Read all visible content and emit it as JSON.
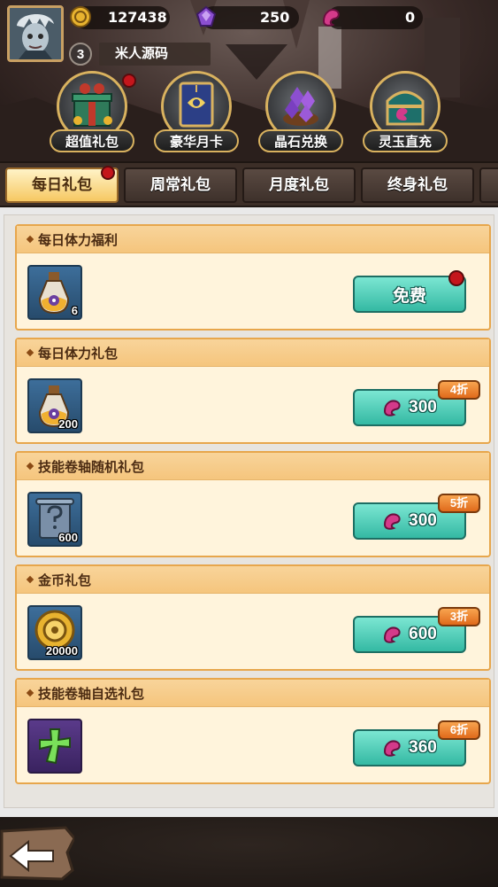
{
  "player": {
    "level": "3",
    "name": "米人源码"
  },
  "resources": [
    {
      "icon": "gold-coin-icon",
      "value": "127438"
    },
    {
      "icon": "purple-crystal-icon",
      "value": "250"
    },
    {
      "icon": "pink-jade-icon",
      "value": "0"
    }
  ],
  "shop_buttons": [
    {
      "label": "超值礼包",
      "icon": "gift-box-icon",
      "has_dot": true
    },
    {
      "label": "豪华月卡",
      "icon": "monthly-card-icon",
      "has_dot": false
    },
    {
      "label": "晶石兑换",
      "icon": "crystal-exchange-icon",
      "has_dot": false
    },
    {
      "label": "灵玉直充",
      "icon": "jade-chest-icon",
      "has_dot": false
    }
  ],
  "tabs": [
    {
      "label": "每日礼包",
      "active": true
    },
    {
      "label": "周常礼包",
      "active": false
    },
    {
      "label": "月度礼包",
      "active": false
    },
    {
      "label": "终身礼包",
      "active": false
    }
  ],
  "packs": [
    {
      "title": "每日体力福利",
      "item_icon": "stamina-potion-icon",
      "qty": "6",
      "button": "免费",
      "price": "",
      "discount": "",
      "free": true
    },
    {
      "title": "每日体力礼包",
      "item_icon": "stamina-potion-icon",
      "qty": "200",
      "button": "",
      "price": "300",
      "discount": "4折",
      "free": false
    },
    {
      "title": "技能卷轴随机礼包",
      "item_icon": "mystery-scroll-icon",
      "qty": "600",
      "button": "",
      "price": "300",
      "discount": "5折",
      "free": false
    },
    {
      "title": "金币礼包",
      "item_icon": "gold-coin-icon",
      "qty": "20000",
      "button": "",
      "price": "600",
      "discount": "3折",
      "free": false
    },
    {
      "title": "技能卷轴自选礼包",
      "item_icon": "green-rune-icon",
      "qty": "",
      "button": "",
      "price": "360",
      "discount": "6折",
      "free": false
    }
  ],
  "colors": {
    "accent_gold": "#d9b25f",
    "card_bg": "#fff4dc",
    "card_header": "#f5c57d",
    "buy_button": "#34b9a3",
    "discount_badge": "#e06a1b",
    "notification_dot": "#c4161c"
  }
}
